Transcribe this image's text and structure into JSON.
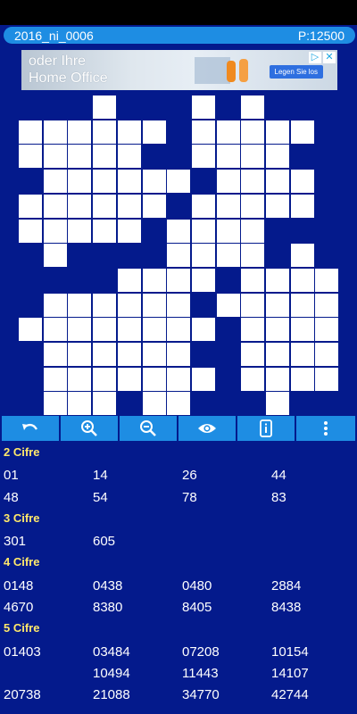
{
  "header": {
    "title": "2016_ni_0006",
    "points": "P:12500"
  },
  "ad": {
    "line1": "oder Ihre",
    "line2": "Home Office",
    "button": "Legen Sie los",
    "play_icon": "play-icon",
    "close_icon": "close-icon"
  },
  "toolbar": [
    {
      "name": "undo-button",
      "icon": "undo-icon"
    },
    {
      "name": "zoom-in-button",
      "icon": "zoom-in-icon"
    },
    {
      "name": "zoom-out-button",
      "icon": "zoom-out-icon"
    },
    {
      "name": "show-solution-button",
      "icon": "eye-icon"
    },
    {
      "name": "info-button",
      "icon": "info-icon"
    },
    {
      "name": "more-options-button",
      "icon": "more-vertical-icon"
    }
  ],
  "sections": [
    {
      "title": "2 Cifre",
      "numbers": [
        "01",
        "14",
        "26",
        "44",
        "48",
        "54",
        "78",
        "83"
      ]
    },
    {
      "title": "3 Cifre",
      "numbers": [
        "301",
        "605"
      ]
    },
    {
      "title": "4 Cifre",
      "numbers": [
        "0148",
        "0438",
        "0480",
        "2884",
        "4670",
        "8380",
        "8405",
        "8438"
      ]
    },
    {
      "title": "5 Cifre",
      "numbers": [
        "01403",
        "03484",
        "07208",
        "10154",
        "",
        "10494",
        "11443",
        "14107",
        "20738",
        "21088",
        "34770",
        "42744"
      ]
    }
  ],
  "colors": {
    "background": "#041a8c",
    "accent": "#1e8de3",
    "section_title": "#ffe96b",
    "cell": "#ffffff"
  }
}
